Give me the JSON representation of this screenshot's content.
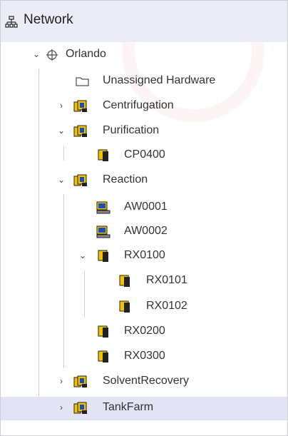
{
  "header": {
    "title": "Network",
    "icon": "network-tree-icon"
  },
  "tree": {
    "orlando": "Orlando",
    "unassigned": "Unassigned Hardware",
    "centrifugation": "Centrifugation",
    "purification": "Purification",
    "cp0400": "CP0400",
    "reaction": "Reaction",
    "aw0001": "AW0001",
    "aw0002": "AW0002",
    "rx0100": "RX0100",
    "rx0101": "RX0101",
    "rx0102": "RX0102",
    "rx0200": "RX0200",
    "rx0300": "RX0300",
    "solventrecovery": "SolventRecovery",
    "tankfarm": "TankFarm"
  },
  "colors": {
    "selection": "#e3e3f6",
    "header_bg": "#ececf7",
    "station_yellow": "#f2c200",
    "station_dark": "#222222",
    "area_blue": "#1a4fb0"
  }
}
